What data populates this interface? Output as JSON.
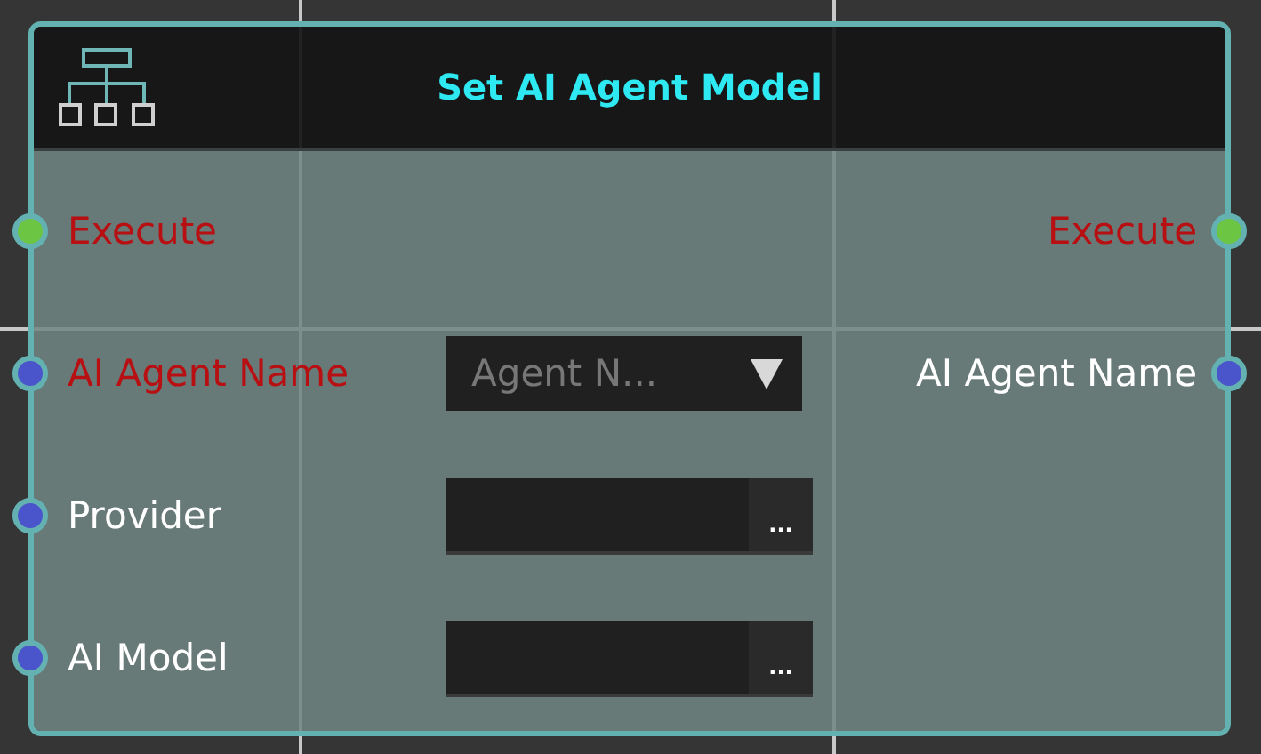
{
  "node": {
    "title": "Set AI Agent Model",
    "rows": [
      {
        "input": {
          "label": "Execute",
          "required": true,
          "color": "#6cc644"
        },
        "output": {
          "label": "Execute",
          "required": true,
          "color": "#6cc644"
        }
      },
      {
        "input": {
          "label": "AI Agent Name",
          "required": true,
          "color": "#4a55cc"
        },
        "control": {
          "kind": "dropdown",
          "value": "Agent N..."
        },
        "output": {
          "label": "AI Agent Name",
          "required": false,
          "color": "#4a55cc"
        }
      },
      {
        "input": {
          "label": "Provider",
          "required": false,
          "color": "#4a55cc"
        },
        "control": {
          "kind": "text",
          "button": "..."
        }
      },
      {
        "input": {
          "label": "AI Model",
          "required": false,
          "color": "#4a55cc"
        },
        "control": {
          "kind": "text",
          "button": "..."
        }
      }
    ]
  }
}
